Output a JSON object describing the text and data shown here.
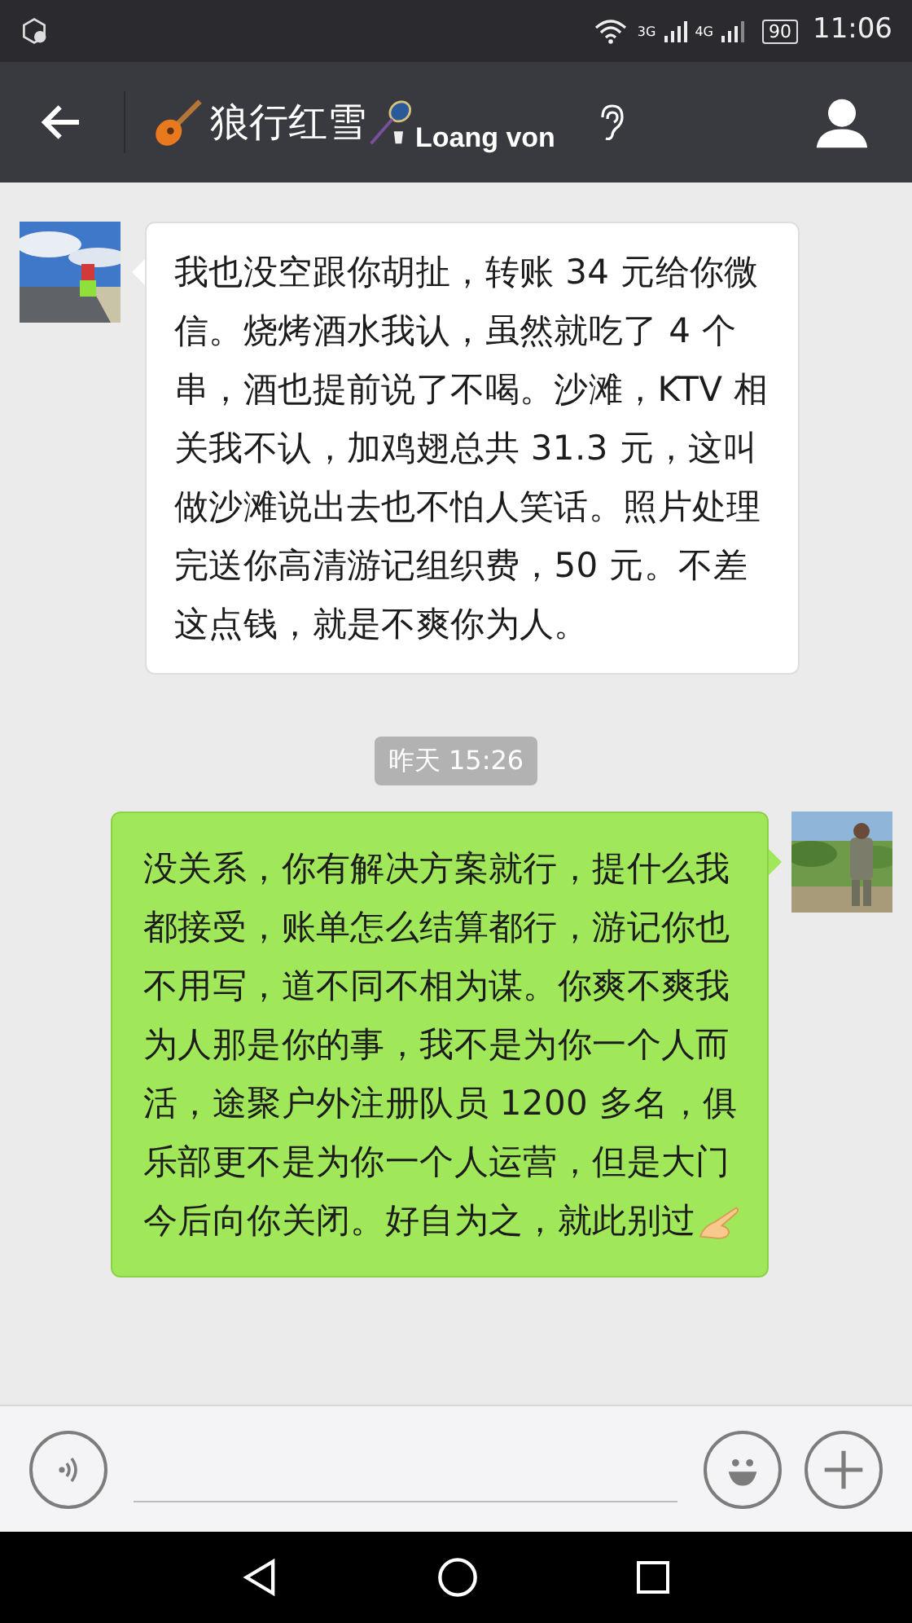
{
  "status_bar": {
    "network_1": "3G",
    "network_2": "4G",
    "battery": "90",
    "time": "11:06"
  },
  "header": {
    "title": "狼行红雪",
    "subtitle": "Loang von"
  },
  "messages": [
    {
      "kind": "message",
      "outgoing": false,
      "text": "我也没空跟你胡扯，转账 34 元给你微信。烧烤酒水我认，虽然就吃了 4 个串，酒也提前说了不喝。沙滩，KTV 相关我不认，加鸡翅总共 31.3 元，这叫做沙滩说出去也不怕人笑话。照片处理完送你高清游记组织费，50 元。不差这点钱，就是不爽你为人。"
    },
    {
      "kind": "time",
      "text": "昨天 15:26"
    },
    {
      "kind": "message",
      "outgoing": true,
      "text": "没关系，你有解决方案就行，提什么我都接受，账单怎么结算都行，游记你也不用写，道不同不相为谋。你爽不爽我为人那是你的事，我不是为你一个人而活，途聚户外注册队员 1200 多名，俱乐部更不是为你一个人运营，但是大门今后向你关闭。好自为之，就此别过",
      "emoji_end": true
    }
  ]
}
